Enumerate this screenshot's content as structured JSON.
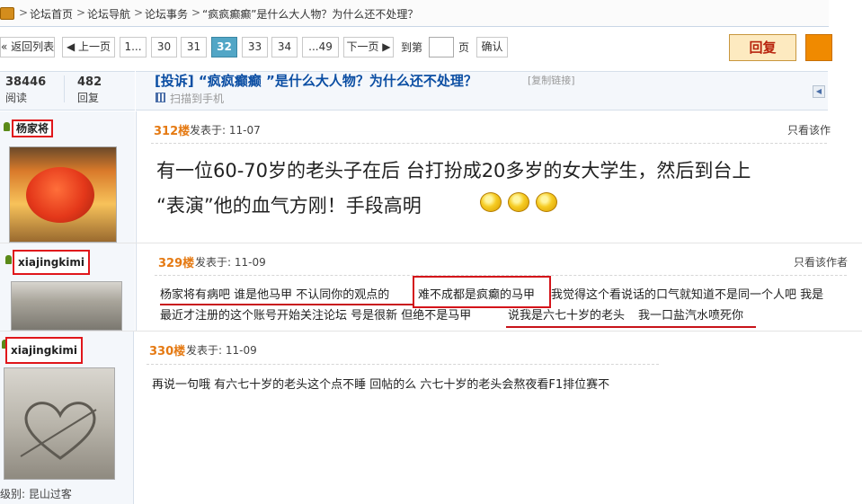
{
  "breadcrumb": {
    "items": [
      "论坛首页",
      "论坛导航",
      "论坛事务",
      "“疯疯癫癫”是什么大人物？为什么还不处理？"
    ],
    "separator": ">"
  },
  "pager": {
    "back_label": "« 返回列表",
    "prev_label": "◀ 上一页",
    "pages": [
      "1...",
      "30",
      "31",
      "32",
      "33",
      "34",
      "...49"
    ],
    "current": "32",
    "next_label": "下一页 ▶",
    "jump_prefix": "到第",
    "jump_suffix": "页",
    "confirm_label": "确认"
  },
  "actions": {
    "reply_label": "回复"
  },
  "thread": {
    "views": "38446",
    "views_label": "阅读",
    "replies": "482",
    "replies_label": "回复",
    "title": "[投诉] “疯疯癫癫 ”是什么大人物？为什么还不处理？",
    "copy_link": "[复制链接]",
    "scan_label": "扫描到手机"
  },
  "posts": [
    {
      "author": "杨家将",
      "floor": "312楼",
      "time": "发表于: 11-07",
      "only_author": "只看该作",
      "lines": [
        "有一位60-70岁的老头子在后  台打扮成20多岁的女大学生，然后到台上",
        "“表演”他的血气方刚！手段高明"
      ]
    },
    {
      "author": "xiajingkimi",
      "floor": "329楼",
      "time": "发表于: 11-09",
      "only_author": "只看该作者",
      "line1_a": "杨家将有病吧  谁是他马甲  不认同你的观点的",
      "line1_b": "难不成都是疯癫的马甲",
      "line1_c": "我觉得这个看说话的口气就知道不是同一个人吧  我是",
      "line2_a": "最近才注册的这个账号开始关注论坛  号是很新  但绝不是马甲 ",
      "line2_b": "说我是六七十岁的老头",
      "line2_c": "我一口盐汽水喷死你"
    },
    {
      "author": "xiajingkimi",
      "floor": "330楼",
      "time": "发表于: 11-09",
      "level": "级别: 昆山过客",
      "line": "再说一句哦  有六七十岁的老头这个点不睡  回帖的么  六七十岁的老头会熬夜看F1排位赛不"
    }
  ],
  "colors": {
    "accent": "#52a6c6",
    "highlight_red": "#d4141a",
    "title_blue": "#0b4ea3",
    "floor_orange": "#e57a13"
  }
}
